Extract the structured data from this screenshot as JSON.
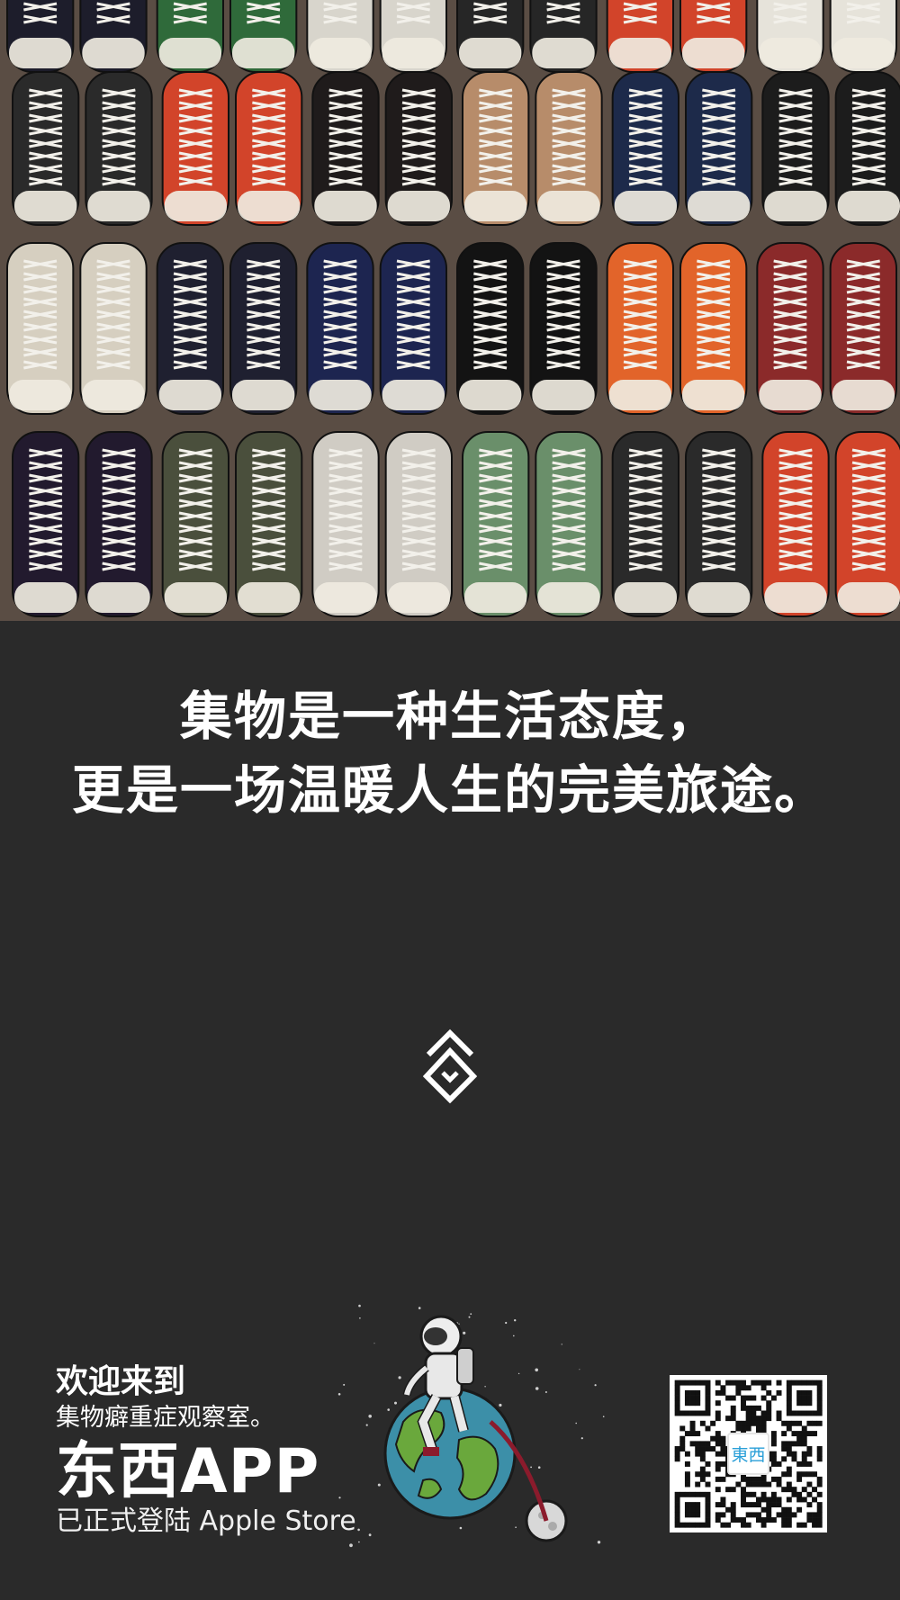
{
  "hero": {
    "icon": "sneakers-photo"
  },
  "headline": {
    "line1": "集物是一种生活态度，",
    "line2": "更是一场温暖人生的完美旅途。"
  },
  "logo_mark": {
    "icon": "dongxi-diamond-icon"
  },
  "promo": {
    "welcome": "欢迎来到",
    "subtitle": "集物癖重症观察室。",
    "app_name": "东西APP",
    "store_line": "已正式登陆 Apple Store"
  },
  "illustration": {
    "icon": "astronaut-on-earth-icon"
  },
  "qr": {
    "icon": "qr-code-icon",
    "logo_text": "東西"
  },
  "colors": {
    "background": "#2a2a2a",
    "text": "#ffffff",
    "qr_logo": "#2a9fd8"
  }
}
